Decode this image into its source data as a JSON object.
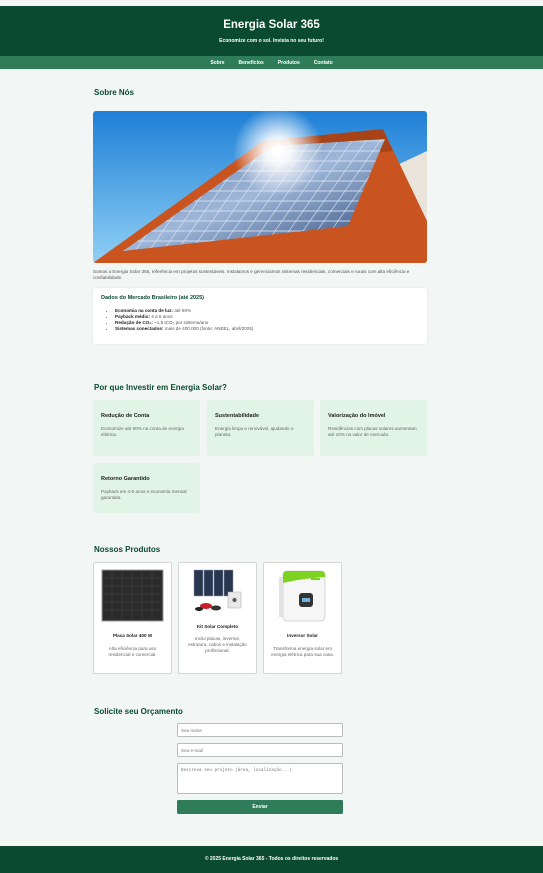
{
  "header": {
    "title": "Energia Solar 365",
    "tagline": "Economize com o sol. Invista no seu futuro!"
  },
  "nav": {
    "items": [
      "Sobre",
      "Benefícios",
      "Produtos",
      "Contato"
    ]
  },
  "about": {
    "title": "Sobre Nós",
    "text": "Somos a Energia Solar 365, referência em projetos sustentáveis. Instalamos e gerenciamos sistemas residenciais, comerciais e rurais com alta eficiência e confiabilidade.",
    "market": {
      "title": "Dados do Mercado Brasileiro (até 2025)",
      "items": [
        {
          "label": "Economia na conta de luz:",
          "value": " até 90%"
        },
        {
          "label": "Payback médio:",
          "value": " 4 a 6 anos"
        },
        {
          "label": "Redução de CO₂:",
          "value": " ~1,5 tCO₂ por sistema/ano"
        },
        {
          "label": "Sistemas conectados:",
          "value": " mais de 400.000 (fonte: ANEEL, abril/2025)"
        }
      ]
    }
  },
  "benefits": {
    "title": "Por que Investir em Energia Solar?",
    "items": [
      {
        "title": "Redução de Conta",
        "desc": "Economize até 90% na conta de energia elétrica."
      },
      {
        "title": "Sustentabilidade",
        "desc": "Energia limpa e renovável, ajudando o planeta."
      },
      {
        "title": "Valorização do Imóvel",
        "desc": "Residências com placas solares aumentam até 10% no valor de mercado."
      },
      {
        "title": "Retorno Garantido",
        "desc": "Payback em 4-6 anos e economia mensal garantida."
      }
    ]
  },
  "products": {
    "title": "Nossos Produtos",
    "items": [
      {
        "name": "Placa Solar 400 W",
        "desc": "Alta eficiência para uso residencial e comercial."
      },
      {
        "name": "Kit Solar Completo",
        "desc": "Inclui placas, inversor, estrutura, cabos e instalação profissional."
      },
      {
        "name": "Inversor Solar",
        "desc": "Transforma energia solar em energia elétrica para sua casa."
      }
    ]
  },
  "contact": {
    "title": "Solicite seu Orçamento",
    "name_placeholder": "Seu nome",
    "email_placeholder": "Seu e-mail",
    "message_placeholder": "Descreva seu projeto (área, localização...)",
    "submit_label": "Enviar"
  },
  "footer": {
    "text": "© 2025 Energia Solar 365 - Todos os direitos reservados"
  },
  "colors": {
    "primary": "#0a4a30",
    "accent": "#2e7d58",
    "benefit_bg": "#e2f4e6",
    "page_bg": "#f2f6f5"
  }
}
